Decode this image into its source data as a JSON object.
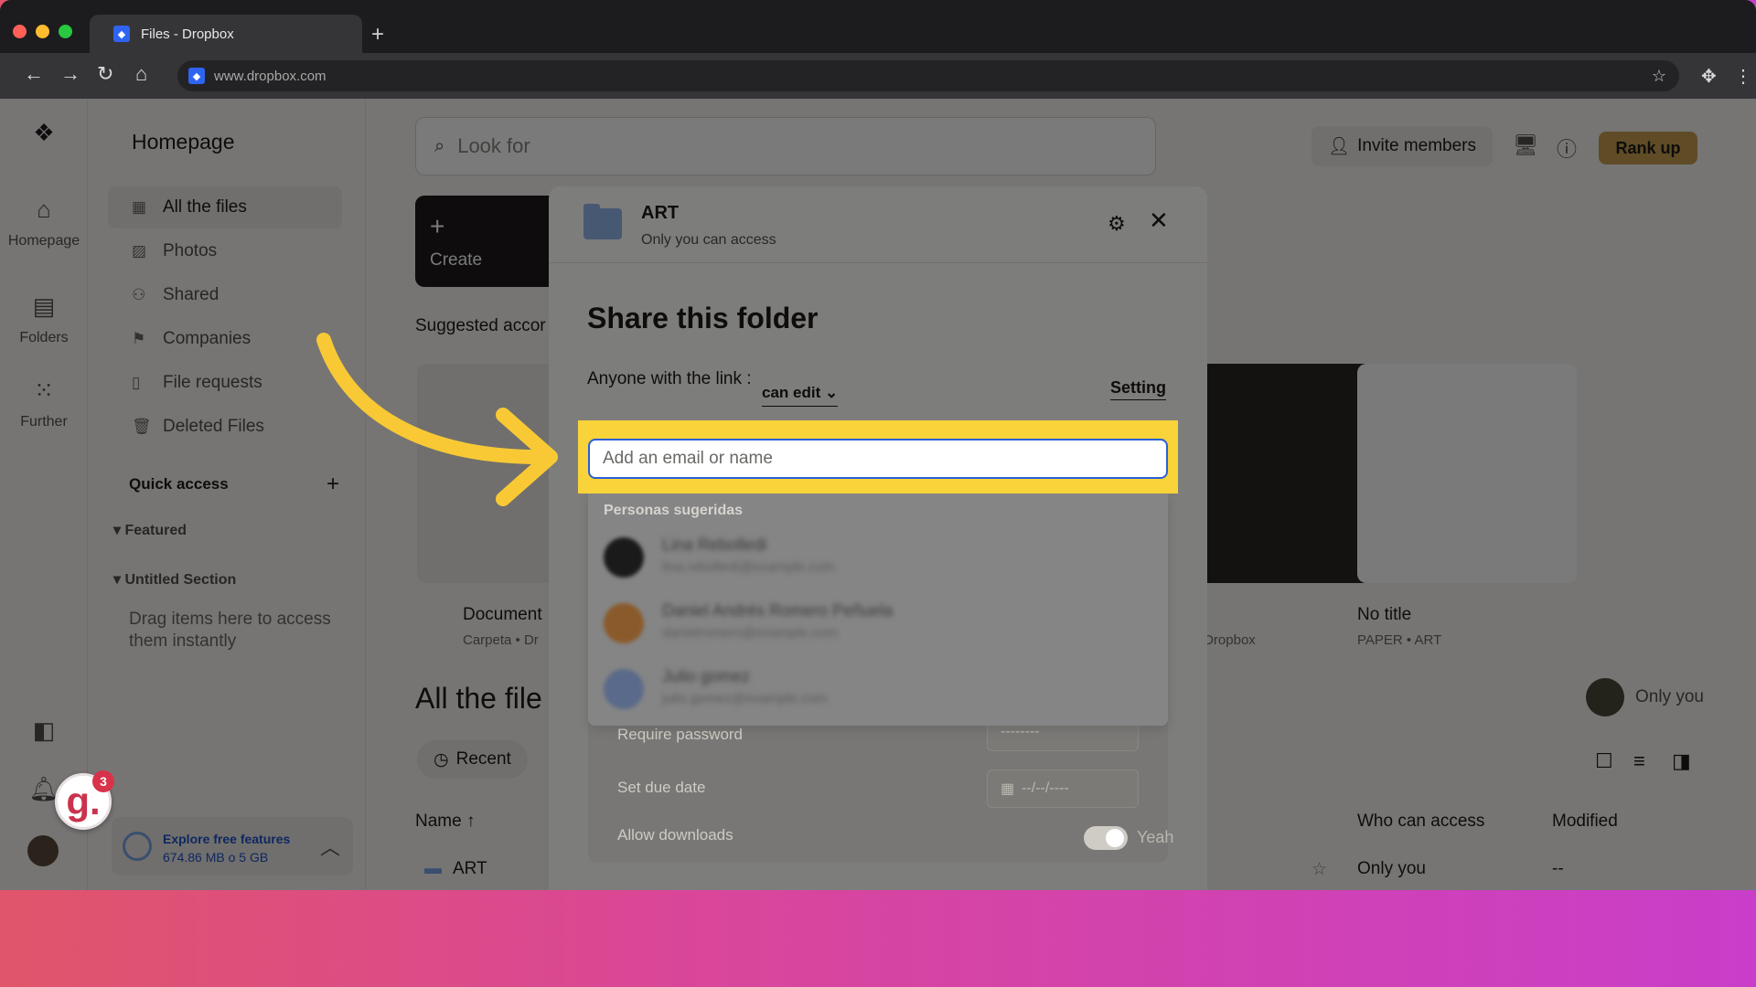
{
  "browser": {
    "tab_title": "Files - Dropbox",
    "url": "www.dropbox.com",
    "new_tab_label": "+"
  },
  "rail": {
    "items": [
      {
        "label": "Homepage",
        "icon": "home-icon"
      },
      {
        "label": "Folders",
        "icon": "folder-icon"
      },
      {
        "label": "Further",
        "icon": "grid-icon"
      }
    ]
  },
  "sidebar": {
    "title": "Homepage",
    "items": [
      {
        "label": "All the files",
        "icon": "files-icon",
        "active": true
      },
      {
        "label": "Photos",
        "icon": "photo-icon"
      },
      {
        "label": "Shared",
        "icon": "shared-icon"
      },
      {
        "label": "Companies",
        "icon": "companies-icon"
      },
      {
        "label": "File requests",
        "icon": "file-request-icon"
      },
      {
        "label": "Deleted Files",
        "icon": "trash-icon"
      }
    ],
    "quick_access": "Quick access",
    "sections": [
      "Featured",
      "Untitled Section"
    ],
    "drag_hint": "Drag items here to access them instantly",
    "storage": {
      "title": "Explore free features",
      "usage": "674.86 MB o 5 GB"
    }
  },
  "topbar": {
    "search_placeholder": "Look for",
    "invite_label": "Invite members",
    "rank_up_label": "Rank up"
  },
  "main": {
    "create_label": "Create",
    "suggested_label": "Suggested accor",
    "cards": [
      {
        "title": "Document",
        "subtitle": "Carpeta • Dr"
      },
      {
        "title": "",
        "subtitle": "ta • Dropbox"
      },
      {
        "title": "No title",
        "subtitle": "PAPER • ART"
      }
    ],
    "all_files_label": "All the file",
    "recent_label": "Recent",
    "only_you_label": "Only you",
    "columns": {
      "name": "Name",
      "who": "Who can access",
      "modified": "Modified"
    },
    "rows": [
      {
        "name": "ART",
        "who": "Only you",
        "modified": "--"
      }
    ]
  },
  "modal": {
    "folder_name": "ART",
    "folder_access": "Only you can access",
    "title": "Share this folder",
    "link_label": "Anyone with the link :",
    "link_permission": "can edit",
    "setting_label": "Setting",
    "email_placeholder": "Add an email or name",
    "email_value": "",
    "suggested_header": "Personas sugeridas",
    "suggested_people": [
      {
        "name": "Lina Rebolledi",
        "email": "lina.rebolledi@example.com",
        "color": "#2b2b2b"
      },
      {
        "name": "Daniel Andrés Romero Peñuela",
        "email": "danielromero@example.com",
        "color": "#e0883a"
      },
      {
        "name": "Julio gomez",
        "email": "julio.gomez@example.com",
        "color": "#8fb0e6"
      }
    ],
    "options": [
      {
        "label": "Require password",
        "value": "--------"
      },
      {
        "label": "Set due date",
        "value": "--/--/----"
      },
      {
        "label": "Allow downloads",
        "toggle_label": "Yeah",
        "enabled": true
      }
    ]
  },
  "widget": {
    "letter": "g.",
    "badge_count": "3"
  },
  "colors": {
    "highlight": "#f8d33a",
    "input_border": "#2a5fd6",
    "rank_up": "#c7a050",
    "dropbox_blue": "#2e64f1"
  }
}
